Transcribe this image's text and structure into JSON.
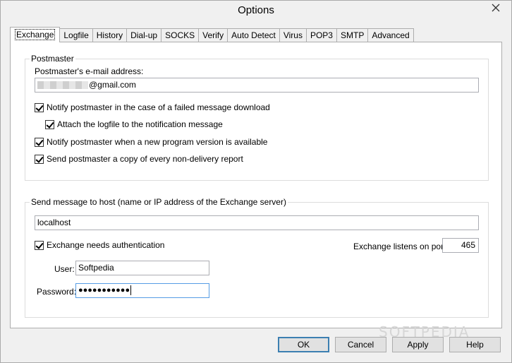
{
  "window": {
    "title": "Options"
  },
  "tabs": [
    "Exchange",
    "Logfile",
    "History",
    "Dial-up",
    "SOCKS",
    "Verify",
    "Auto Detect",
    "Virus",
    "POP3",
    "SMTP",
    "Advanced"
  ],
  "postmaster": {
    "group_label": "Postmaster",
    "email_label": "Postmaster's e-mail address:",
    "email_value": "@gmail.com",
    "checkboxes": {
      "notify_failed": "Notify postmaster in the case of a failed message download",
      "attach_logfile": "Attach the logfile to the notification message",
      "notify_version": "Notify postmaster when a new program version is available",
      "send_copy": "Send postmaster a copy of every non-delivery report"
    }
  },
  "host": {
    "group_label": "Send message to host (name or IP address of the Exchange server)",
    "host_value": "localhost",
    "auth_label": "Exchange needs authentication",
    "port_label": "Exchange listens on port:",
    "port_value": "465",
    "user_label": "User:",
    "user_value": "Softpedia",
    "password_label": "Password:",
    "password_value": "●●●●●●●●●●●"
  },
  "buttons": {
    "ok": "OK",
    "cancel": "Cancel",
    "apply": "Apply",
    "help": "Help"
  },
  "watermark": "SOFTPEDIA"
}
